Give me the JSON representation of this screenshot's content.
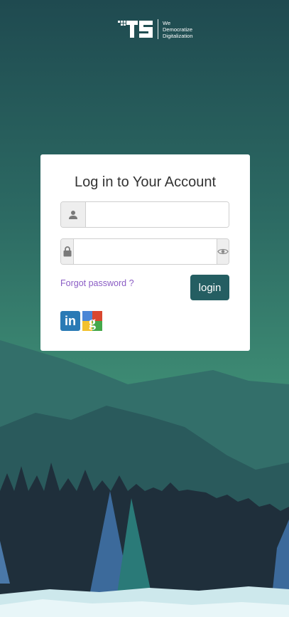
{
  "brand": {
    "logo_letters": "TS",
    "tagline_lines": [
      "We",
      "Democratize",
      "Digitalization"
    ]
  },
  "login_card": {
    "title": "Log in to Your Account",
    "username": {
      "value": "",
      "placeholder": ""
    },
    "password": {
      "value": "",
      "placeholder": ""
    },
    "forgot_label": "Forgot password ?",
    "login_label": "login"
  },
  "social_login": {
    "providers": [
      "linkedin",
      "google"
    ]
  },
  "icons": {
    "username": "user-icon",
    "password": "lock-icon",
    "toggle_password": "eye-icon"
  },
  "colors": {
    "primary_button": "#245e62",
    "link": "#8a5cc4",
    "sky_top": "#1f4a50",
    "sky_mid": "#3d8a73",
    "linkedin": "#2a7ab5"
  }
}
